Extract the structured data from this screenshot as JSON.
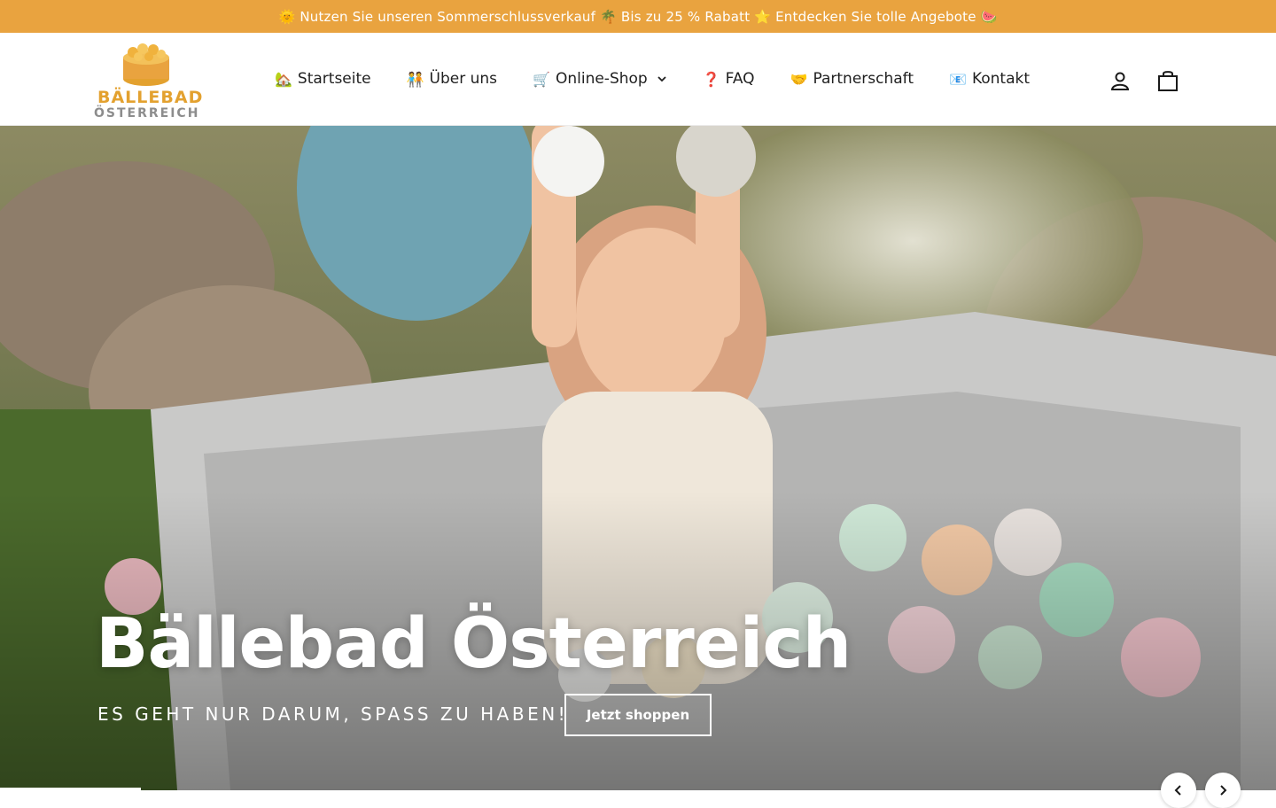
{
  "announcement": {
    "text": "🌞 Nutzen Sie unseren Sommerschlussverkauf 🌴 Bis zu 25 % Rabatt ⭐ Entdecken Sie tolle Angebote 🍉"
  },
  "header": {
    "logo": {
      "line1": "BÄLLEBAD",
      "line2": "ÖSTERREICH"
    },
    "nav": [
      {
        "emoji": "🏡",
        "label": "Startseite"
      },
      {
        "emoji": "🧑‍🤝‍🧑",
        "label": "Über uns"
      },
      {
        "emoji": "🛒",
        "label": "Online-Shop",
        "has_dropdown": true
      },
      {
        "emoji": "❓",
        "label": "FAQ"
      },
      {
        "emoji": "🤝",
        "label": "Partnerschaft"
      },
      {
        "emoji": "📧",
        "label": "Kontakt"
      }
    ],
    "icons": [
      "account-icon",
      "cart-icon"
    ]
  },
  "hero": {
    "title": "Bällebad Österreich",
    "subtitle": "ES GEHT NUR DARUM, SPASS ZU HABEN!",
    "cta_label": "Jetzt shoppen"
  },
  "slider": {
    "prev_icon": "chevron-left-icon",
    "next_icon": "chevron-right-icon"
  },
  "colors": {
    "announcement_bg": "#e9a33f",
    "logo_gold": "#e3a12f",
    "logo_grey": "#8d8d8d"
  }
}
